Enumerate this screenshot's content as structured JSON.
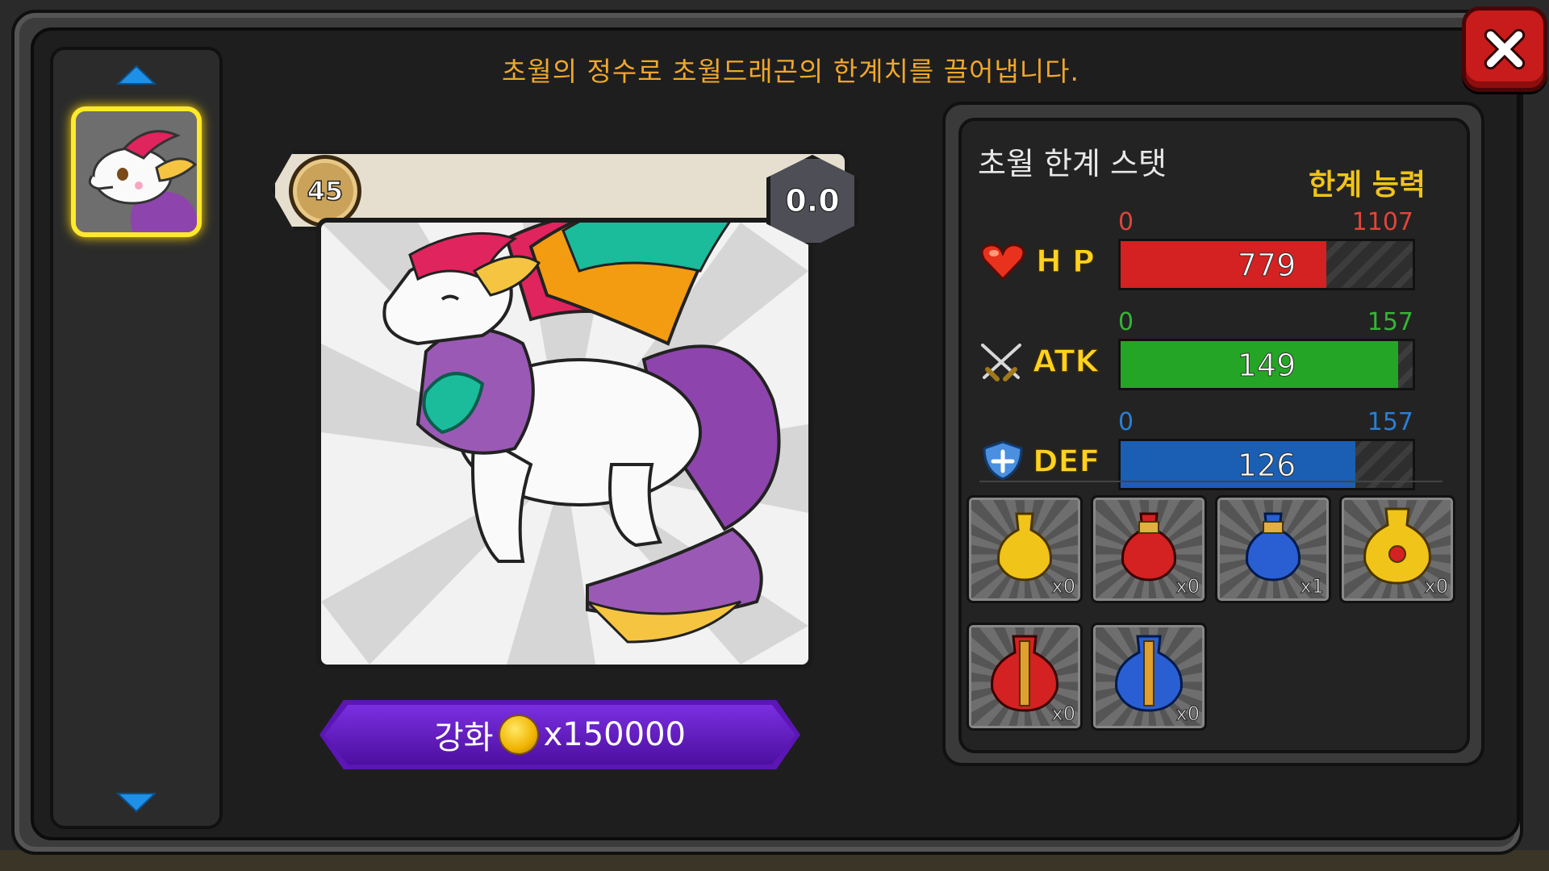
{
  "description": "초월의 정수로 초월드래곤의 한계치를 끌어냅니다.",
  "card": {
    "level": "45",
    "grade": "0.0"
  },
  "upgrade": {
    "label": "강화",
    "cost": "x150000"
  },
  "stat_panel": {
    "title": "초월 한계 스탯",
    "subtitle": "한계 능력",
    "stats": [
      {
        "label": "H P",
        "icon": "heart-icon",
        "min": "0",
        "max": "1107",
        "value": "779",
        "value_num": 779,
        "max_num": 1107,
        "color": "#d42121",
        "label_color": "#e0453a"
      },
      {
        "label": "ATK",
        "icon": "crossed-swords-icon",
        "min": "0",
        "max": "157",
        "value": "149",
        "value_num": 149,
        "max_num": 157,
        "color": "#25a525",
        "label_color": "#35b535"
      },
      {
        "label": "DEF",
        "icon": "shield-icon",
        "min": "0",
        "max": "157",
        "value": "126",
        "value_num": 126,
        "max_num": 157,
        "color": "#1a5fb4",
        "label_color": "#2a7fd4"
      }
    ]
  },
  "items": [
    {
      "name": "gold-essence-small",
      "count": "x0",
      "color": "#f0c419"
    },
    {
      "name": "red-essence-small",
      "count": "x0",
      "color": "#d42121"
    },
    {
      "name": "blue-essence-small",
      "count": "x1",
      "color": "#2a5fd4"
    },
    {
      "name": "gold-essence-large",
      "count": "x0",
      "color": "#f0c419"
    },
    {
      "name": "red-essence-large",
      "count": "x0",
      "color": "#d42121"
    },
    {
      "name": "blue-essence-large",
      "count": "x0",
      "color": "#2a5fd4"
    }
  ]
}
